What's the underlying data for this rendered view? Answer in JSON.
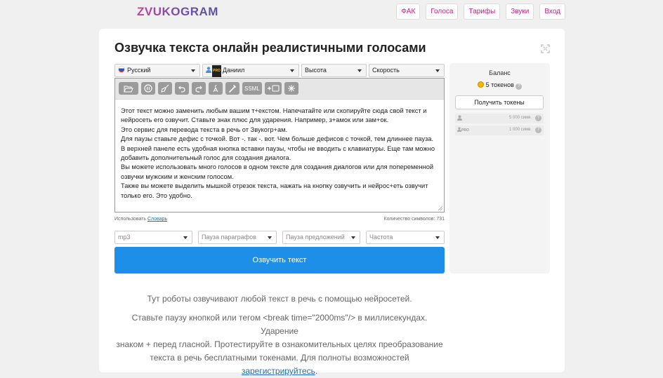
{
  "brand": {
    "name": "ZVUKOGRAM"
  },
  "nav": {
    "items": [
      "ФАК",
      "Голоса",
      "Тарифы",
      "Звуки",
      "Вход"
    ]
  },
  "page": {
    "title": "Озвучка текста онлайн реалистичными голосами"
  },
  "selects": {
    "language": "Русский",
    "voice": "Даниил",
    "voice_badge": "PRO",
    "pitch": "Высота",
    "speed": "Скорость"
  },
  "toolbar": {
    "ssml_label": "SSML"
  },
  "editor": {
    "lines": [
      "Этот текст можно заменить любым вашим т+екстом. Напечатайте или скопируйте сюда свой текст и",
      "нейросеть его озвучит. Ставьте знак плюс для ударения. Например, з+амок или зам+ок.",
      "Это сервис для перевода текста в речь от Звукогр+ам.",
      "Для паузы ставьте дефис с точкой. Вот -. так -. вот. Чем больше дефисов с точкой, тем длиннее пауза.",
      "В верхней панеле есть удобная кнопка вставки паузы, чтобы не вводить с клавиатуры. Еще там можно",
      "добавить дополнительный голос для создания диалога.",
      "Вы можете использовать много голосов в одном тексте для создания диалогов или для попеременной",
      "озвучки мужским и женским голосом.",
      "Также вы можете выделить мышкой отрезок текста, нажать на кнопку озвучить и нейрос+еть озвучит",
      "только его. Это удобно."
    ]
  },
  "dictionary": {
    "prefix": "Использовать ",
    "link": "Словарь"
  },
  "char_count": {
    "label": "Количество символов:",
    "value": "731"
  },
  "options": {
    "format": "mp3",
    "paragraph_pause": "Пауза параграфов",
    "sentence_pause": "Пауза предложений",
    "frequency": "Частота"
  },
  "submit": {
    "label": "Озвучить текст"
  },
  "balance": {
    "title": "Баланс",
    "tokens": "5 токенов",
    "get_button": "Получить токены",
    "quota_basic": "5 000 симв.",
    "quota_pro": "1 000 симв.",
    "pro_badge": "PRO"
  },
  "info": {
    "line1": "Тут роботы озвучивают любой текст в речь с помощью нейросетей.",
    "p2a": "Ставьте паузу кнопкой или тегом <break time=\"2000ms\"/> в миллисекундах. Ударение",
    "p2b": "знаком + перед гласной. Протестируйте в ознакомительных целях преобразование",
    "p2c": "текста в речь бесплатными токенами. Для полноты возможностей ",
    "register_link": "зарегистрируйтесь",
    "p2d": "."
  },
  "colors": {
    "accent": "#c2237a",
    "primary": "#1d8fe8",
    "toolbar_button": "#9a9a9a"
  }
}
